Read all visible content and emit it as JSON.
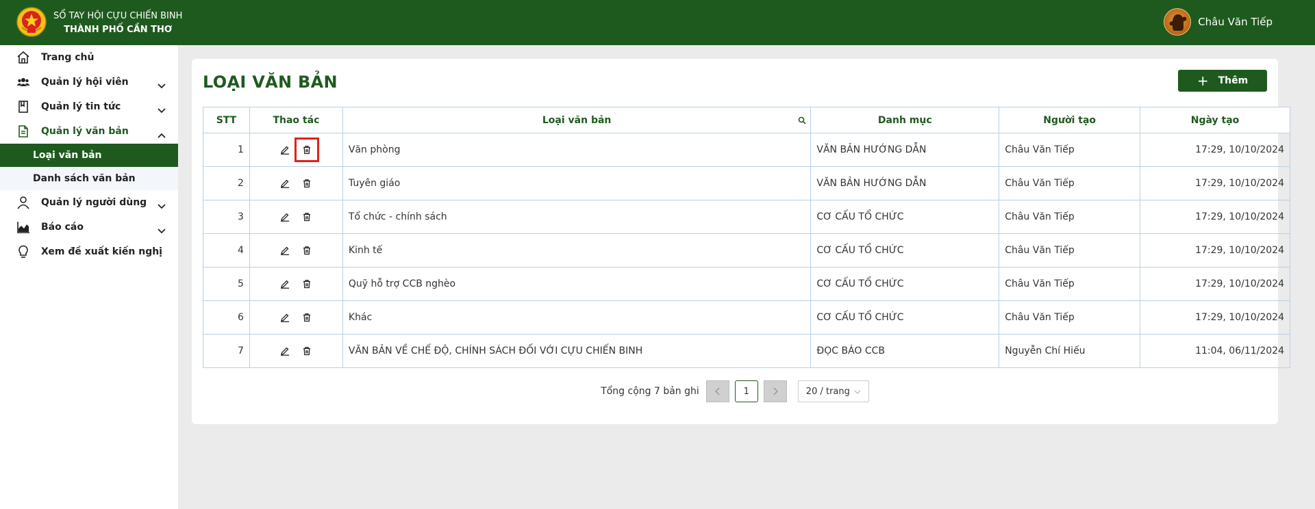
{
  "header": {
    "brand_line1": "SỔ TAY HỘI CỰU CHIẾN BINH",
    "brand_line2": "THÀNH PHỐ CẦN THƠ",
    "user_name": "Châu Văn Tiếp"
  },
  "sidebar": {
    "items": [
      {
        "label": "Trang chủ",
        "icon": "home-icon"
      },
      {
        "label": "Quản lý hội viên",
        "icon": "users-icon"
      },
      {
        "label": "Quản lý tin tức",
        "icon": "bookmark-icon"
      },
      {
        "label": "Quản lý văn bản",
        "icon": "document-icon"
      },
      {
        "label": "Quản lý người dùng",
        "icon": "user-icon"
      },
      {
        "label": "Báo cáo",
        "icon": "chart-icon"
      },
      {
        "label": "Xem đề xuất kiến nghị",
        "icon": "bulb-icon"
      }
    ],
    "sub_items": [
      {
        "label": "Loại văn bản",
        "active": true
      },
      {
        "label": "Danh sách văn bản",
        "active": false
      }
    ]
  },
  "main": {
    "title": "LOẠI VĂN BẢN",
    "add_label": "Thêm",
    "columns": [
      "STT",
      "Thao tác",
      "Loại văn bản",
      "Danh mục",
      "Người tạo",
      "Ngày tạo"
    ],
    "rows": [
      {
        "stt": "1",
        "type": "Văn phòng",
        "category": "VĂN BẢN HƯỚNG DẪN",
        "creator": "Châu Văn Tiếp",
        "date": "17:29, 10/10/2024"
      },
      {
        "stt": "2",
        "type": "Tuyên giáo",
        "category": "VĂN BẢN HƯỚNG DẪN",
        "creator": "Châu Văn Tiếp",
        "date": "17:29, 10/10/2024"
      },
      {
        "stt": "3",
        "type": "Tổ chức - chính sách",
        "category": "CƠ CẤU TỔ CHỨC",
        "creator": "Châu Văn Tiếp",
        "date": "17:29, 10/10/2024"
      },
      {
        "stt": "4",
        "type": "Kinh tế",
        "category": "CƠ CẤU TỔ CHỨC",
        "creator": "Châu Văn Tiếp",
        "date": "17:29, 10/10/2024"
      },
      {
        "stt": "5",
        "type": "Quỹ hỗ trợ CCB nghèo",
        "category": "CƠ CẤU TỔ CHỨC",
        "creator": "Châu Văn Tiếp",
        "date": "17:29, 10/10/2024"
      },
      {
        "stt": "6",
        "type": "Khác",
        "category": "CƠ CẤU TỔ CHỨC",
        "creator": "Châu Văn Tiếp",
        "date": "17:29, 10/10/2024"
      },
      {
        "stt": "7",
        "type": "VĂN BẢN VỀ CHẾ ĐỘ, CHÍNH SÁCH ĐỐI VỚI CỰU CHIẾN BINH",
        "category": "ĐỌC BÁO CCB",
        "creator": "Nguyễn Chí Hiếu",
        "date": "11:04, 06/11/2024"
      }
    ],
    "pagination": {
      "total": "Tổng cộng 7 bản ghi",
      "current_page": "1",
      "page_size": "20 / trang"
    }
  },
  "colors": {
    "brand": "#1e5a1e",
    "highlight": "#e0201c",
    "border": "#b9cfe7"
  }
}
